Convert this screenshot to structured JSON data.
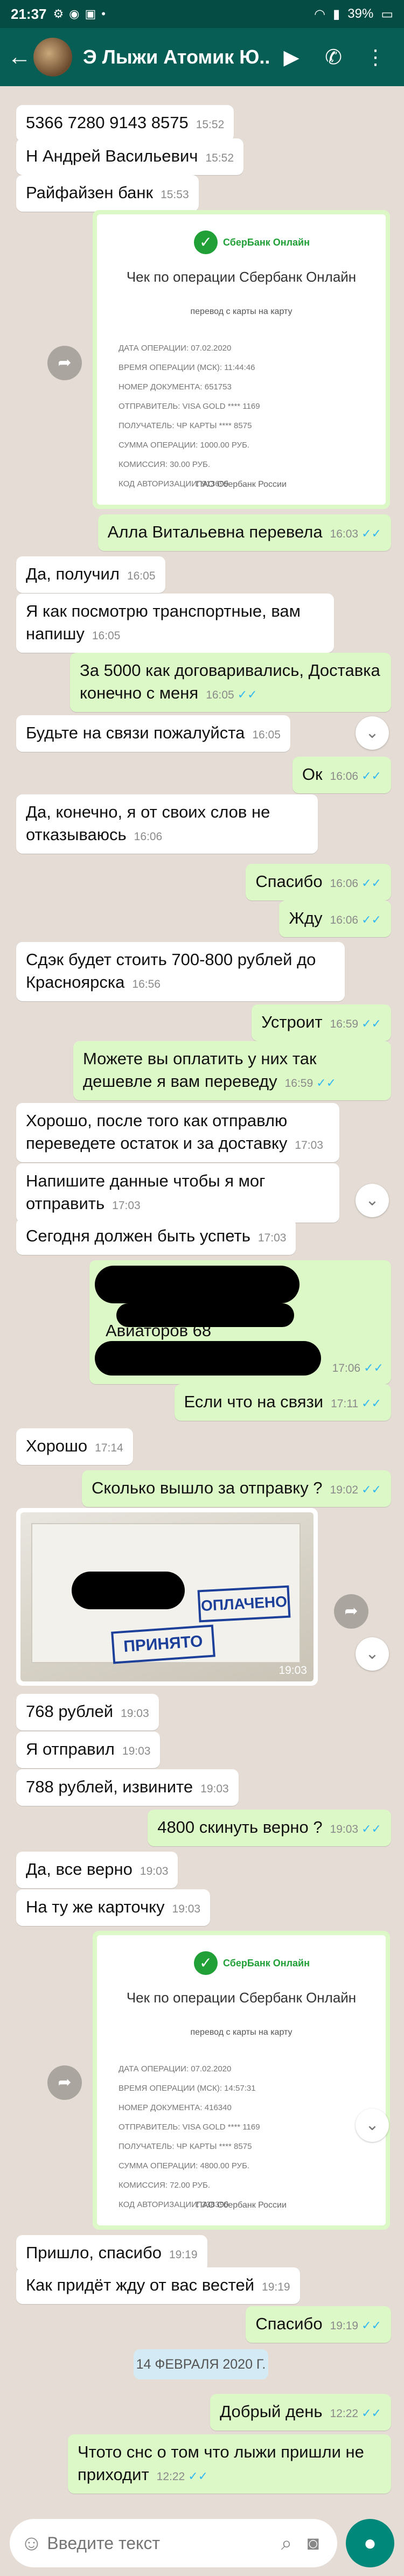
{
  "status_bar": {
    "time": "21:37",
    "battery": "39%"
  },
  "header": {
    "title": "Э Лыжи Атомик Ю..."
  },
  "messages": {
    "m1": {
      "text": "5366 7280 9143 8575",
      "time": "15:52"
    },
    "m2": {
      "text": "Н Андрей Васильевич",
      "time": "15:52"
    },
    "m3": {
      "text": "Райфайзен банк",
      "time": "15:53"
    },
    "m4": {
      "time": "16:03"
    },
    "m5": {
      "text": "Алла Витальевна перевела",
      "time": "16:03"
    },
    "m6": {
      "text": "Да, получил",
      "time": "16:05"
    },
    "m7": {
      "text": "Я как посмотрю транспортные, вам напишу",
      "time": "16:05"
    },
    "m8": {
      "text": "За 5000 как договаривались, Доставка конечно с меня",
      "time": "16:05"
    },
    "m9": {
      "text": "Будьте на связи пожалуйста",
      "time": "16:05"
    },
    "m10": {
      "text": "Ок",
      "time": "16:06"
    },
    "m11": {
      "text": "Да, конечно, я от своих слов не отказываюсь",
      "time": "16:06"
    },
    "m12": {
      "text": "Спасибо",
      "time": "16:06"
    },
    "m13": {
      "text": "Жду",
      "time": "16:06"
    },
    "m14": {
      "text": "Сдэк будет стоить 700-800 рублей до Красноярска",
      "time": "16:56"
    },
    "m15": {
      "text": "Устроит",
      "time": "16:59"
    },
    "m16": {
      "text": "Можете вы оплатить у них так дешевле я вам переведу",
      "time": "16:59"
    },
    "m17": {
      "text": "Хорошо, после того как отправлю переведете остаток и за доставку",
      "time": "17:03"
    },
    "m18": {
      "text": "Напишите данные чтобы я мог отправить",
      "time": "17:03"
    },
    "m19": {
      "text": "Сегодня должен быть успеть",
      "time": "17:03"
    },
    "m20": {
      "text": "Авиаторов 68",
      "time": "17:06"
    },
    "m21": {
      "text": "Если что на связи",
      "time": "17:11"
    },
    "m22": {
      "text": "Хорошо",
      "time": "17:14"
    },
    "m23": {
      "text": "Сколько вышло за отправку ?",
      "time": "19:02"
    },
    "m24": {
      "time": "19:03",
      "label_paid": "ОПЛАЧЕНО",
      "label_accepted": "ПРИНЯТО"
    },
    "m25": {
      "text": "768 рублей",
      "time": "19:03"
    },
    "m26": {
      "text": "Я отправил",
      "time": "19:03"
    },
    "m27": {
      "text": "788 рублей, извините",
      "time": "19:03"
    },
    "m28": {
      "text": "4800 скинуть верно ?",
      "time": "19:03"
    },
    "m29": {
      "text": "Да, все верно",
      "time": "19:03"
    },
    "m30": {
      "text": "На ту же карточку",
      "time": "19:03"
    },
    "m31": {
      "time": "19:18"
    },
    "m32": {
      "text": "Пришло, спасибо",
      "time": "19:19"
    },
    "m33": {
      "text": "Как придёт жду от вас вестей",
      "time": "19:19"
    },
    "m34": {
      "text": "Спасибо",
      "time": "19:19"
    },
    "m35": {
      "text": "Добрый день",
      "time": "12:22"
    },
    "m36": {
      "text": "Чтото снс о том что лыжи пришли не приходит",
      "time": "12:22"
    }
  },
  "receipt1": {
    "brand": "СберБанк Онлайн",
    "title": "Чек по операции Сбербанк Онлайн",
    "subtitle": "перевод с карты на карту",
    "date": "ДАТА ОПЕРАЦИИ: 07.02.2020",
    "time": "ВРЕМЯ ОПЕРАЦИИ (МСК): 11:44:46",
    "doc": "НОМЕР ДОКУМЕНТА: 651753",
    "sender": "ОТПРАВИТЕЛЬ: VISA GOLD **** 1169",
    "receiver": "ПОЛУЧАТЕЛЬ: ЧР КАРТЫ **** 8575",
    "amount": "СУММА ОПЕРАЦИИ: 1000.00 РУБ.",
    "fee": "КОМИССИЯ: 30.00 РУБ.",
    "auth": "КОД АВТОРИЗАЦИИ: 913699",
    "footer": "ПАО Сбербанк России"
  },
  "receipt2": {
    "brand": "СберБанк Онлайн",
    "title": "Чек по операции Сбербанк Онлайн",
    "subtitle": "перевод с карты на карту",
    "date": "ДАТА ОПЕРАЦИИ: 07.02.2020",
    "time": "ВРЕМЯ ОПЕРАЦИИ (МСК): 14:57:31",
    "doc": "НОМЕР ДОКУМЕНТА: 416340",
    "sender": "ОТПРАВИТЕЛЬ: VISA GOLD **** 1169",
    "receiver": "ПОЛУЧАТЕЛЬ: ЧР КАРТЫ **** 8575",
    "amount": "СУММА ОПЕРАЦИИ: 4800.00 РУБ.",
    "fee": "КОМИССИЯ: 72.00 РУБ.",
    "auth": "КОД АВТОРИЗАЦИИ: 338390",
    "footer": "ПАО Сбербанк России"
  },
  "date_divider": "14 ФЕВРАЛЯ 2020 Г.",
  "input": {
    "placeholder": "Введите текст"
  }
}
